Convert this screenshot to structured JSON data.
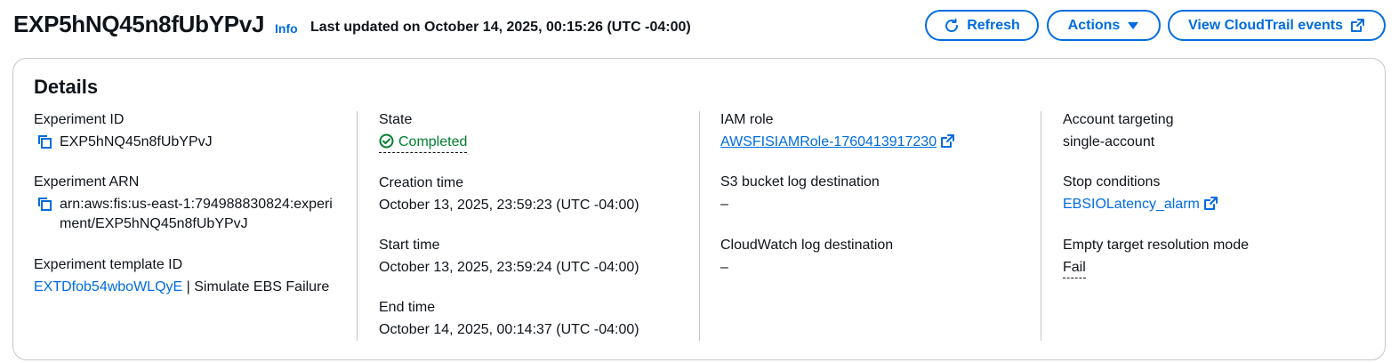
{
  "header": {
    "title": "EXP5hNQ45n8fUbYPvJ",
    "info_label": "Info",
    "last_updated": "Last updated on October 14, 2025, 00:15:26 (UTC -04:00)",
    "refresh_label": "Refresh",
    "actions_label": "Actions",
    "cloudtrail_label": "View CloudTrail events"
  },
  "details": {
    "title": "Details",
    "experiment_id_label": "Experiment ID",
    "experiment_id": "EXP5hNQ45n8fUbYPvJ",
    "experiment_arn_label": "Experiment ARN",
    "experiment_arn": "arn:aws:fis:us-east-1:794988830824:experiment/EXP5hNQ45n8fUbYPvJ",
    "template_id_label": "Experiment template ID",
    "template_id": "EXTDfob54wboWLQyE",
    "template_sep": " | ",
    "template_name": "Simulate EBS Failure",
    "state_label": "State",
    "state": "Completed",
    "creation_time_label": "Creation time",
    "creation_time": "October 13, 2025, 23:59:23 (UTC -04:00)",
    "start_time_label": "Start time",
    "start_time": "October 13, 2025, 23:59:24 (UTC -04:00)",
    "end_time_label": "End time",
    "end_time": "October 14, 2025, 00:14:37 (UTC -04:00)",
    "iam_role_label": "IAM role",
    "iam_role": "AWSFISIAMRole-1760413917230",
    "s3_label": "S3 bucket log destination",
    "s3_value": "–",
    "cloudwatch_label": "CloudWatch log destination",
    "cloudwatch_value": "–",
    "account_targeting_label": "Account targeting",
    "account_targeting": "single-account",
    "stop_conditions_label": "Stop conditions",
    "stop_condition": "EBSIOLatency_alarm",
    "empty_target_label": "Empty target resolution mode",
    "empty_target": "Fail"
  },
  "icons": {
    "refresh": "refresh-icon",
    "caret": "caret-down-icon",
    "external": "external-link-icon",
    "copy": "copy-icon",
    "status": "check-circle-icon"
  },
  "colors": {
    "link": "#006ce0",
    "success": "#00802f",
    "border": "#c6c6cd",
    "text": "#0f141a"
  }
}
